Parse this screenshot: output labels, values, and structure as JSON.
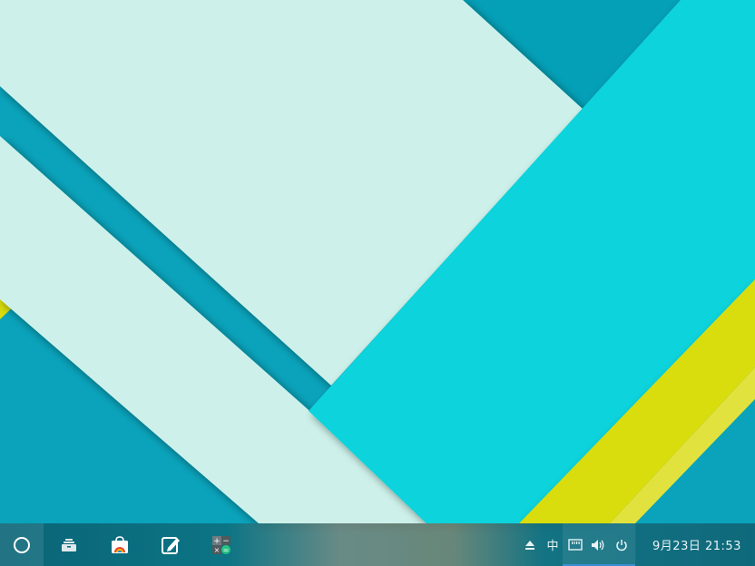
{
  "taskbar": {
    "clock": "9月23日  21:53",
    "ime_label": "中"
  },
  "colors": {
    "background": "#0aa3bb",
    "pale_panel": "#cdf1ea",
    "cyan_panel": "#11d3dc",
    "yellow_stripe": "#d9dd0c",
    "taskbar": "#0a5f70",
    "accent": "#3a8fd4"
  },
  "icons": {
    "launcher": "launcher-circle-icon",
    "apps": [
      "file-manager-icon",
      "app-store-icon",
      "text-editor-icon",
      "calculator-icon"
    ],
    "tray": [
      "eject-icon",
      "ime-icon",
      "network-icon",
      "volume-icon",
      "power-icon"
    ]
  }
}
